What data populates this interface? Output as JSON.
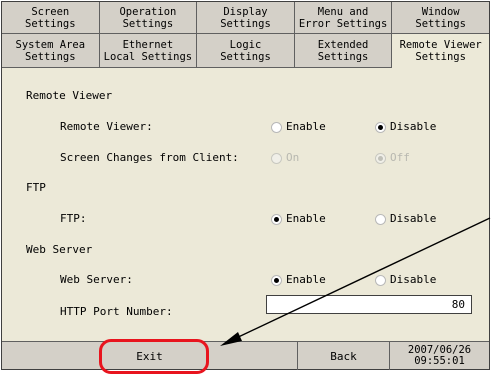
{
  "tabs_row1": [
    {
      "line1": "Screen",
      "line2": "Settings"
    },
    {
      "line1": "Operation",
      "line2": "Settings"
    },
    {
      "line1": "Display",
      "line2": "Settings"
    },
    {
      "line1": "Menu and",
      "line2": "Error Settings"
    },
    {
      "line1": "Window",
      "line2": "Settings"
    }
  ],
  "tabs_row2": [
    {
      "line1": "System Area",
      "line2": "Settings"
    },
    {
      "line1": "Ethernet",
      "line2": "Local Settings"
    },
    {
      "line1": "Logic",
      "line2": "Settings"
    },
    {
      "line1": "Extended",
      "line2": "Settings"
    },
    {
      "line1": "Remote Viewer",
      "line2": "Settings"
    }
  ],
  "active_tab": "Remote Viewer Settings",
  "sections": {
    "remote_viewer": {
      "title": "Remote Viewer",
      "remote_viewer_label": "Remote Viewer:",
      "screen_changes_label": "Screen Changes from Client:",
      "enable": "Enable",
      "disable": "Disable",
      "on": "On",
      "off": "Off",
      "remote_viewer_value": "Disable",
      "screen_changes_value": "Off"
    },
    "ftp": {
      "title": "FTP",
      "ftp_label": "FTP:",
      "enable": "Enable",
      "disable": "Disable",
      "value": "Enable"
    },
    "web_server": {
      "title": "Web Server",
      "web_server_label": "Web Server:",
      "enable": "Enable",
      "disable": "Disable",
      "value": "Enable",
      "http_port_label": "HTTP Port Number:",
      "http_port_value": "80"
    }
  },
  "bottom": {
    "exit": "Exit",
    "back": "Back",
    "date": "2007/06/26",
    "time": "09:55:01"
  },
  "colors": {
    "highlight_ring": "#e8141e",
    "panel_bg": "#d4d0c8",
    "content_bg": "#ece9d8"
  }
}
